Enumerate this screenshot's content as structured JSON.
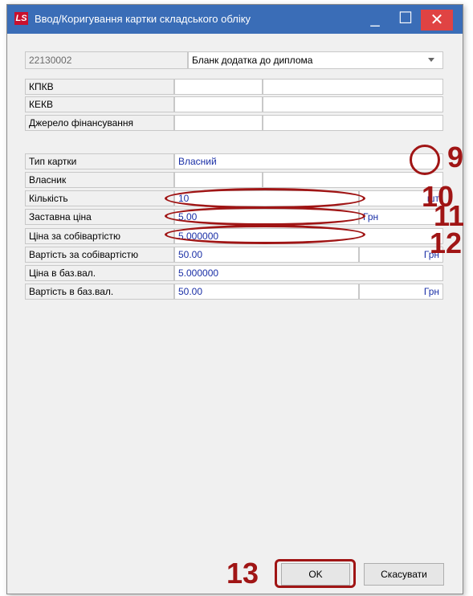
{
  "window": {
    "logo_text": "LS",
    "title": "Ввод/Коригування картки складського обліку",
    "controls": {
      "minimize": "_",
      "maximize": "☐",
      "close": "✕"
    }
  },
  "header": {
    "code": "22130002",
    "name": "Бланк додатка до диплома"
  },
  "budget": [
    {
      "label": "КПКВ"
    },
    {
      "label": "КЕКВ"
    },
    {
      "label": "Джерело фінансування"
    }
  ],
  "card": {
    "type": {
      "label": "Тип картки",
      "value": "Власний"
    },
    "owner": {
      "label": "Власник"
    },
    "quantity": {
      "label": "Кількість",
      "value": "10",
      "unit": "шт"
    },
    "pledge_price": {
      "label": "Заставна ціна",
      "value": "5.00",
      "unit": "Грн"
    },
    "cost_price": {
      "label": "Ціна за собівартістю",
      "value": "5.000000"
    },
    "cost_value": {
      "label": "Вартість за собівартістю",
      "value": "50.00",
      "unit": "Грн"
    },
    "base_price": {
      "label": "Ціна в баз.вал.",
      "value": "5.000000"
    },
    "base_value": {
      "label": "Вартість в баз.вал.",
      "value": "50.00",
      "unit": "Грн"
    }
  },
  "annotations": {
    "n9": "9",
    "n10": "10",
    "n11": "11",
    "n12": "12",
    "n13": "13"
  },
  "buttons": {
    "ok": "OK",
    "cancel": "Скасувати"
  },
  "colors": {
    "title_bar": "#3a6db7",
    "close_button": "#e04343",
    "annotation": "#a01515",
    "value_text": "#1a2fa6"
  }
}
